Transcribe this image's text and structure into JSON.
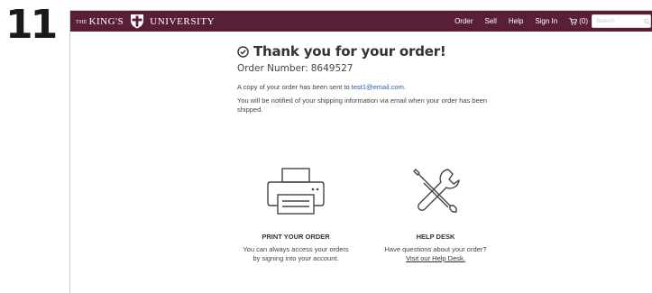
{
  "step": "11",
  "header": {
    "brand": {
      "prefix": "THE",
      "name": "KING'S",
      "suffix": "UNIVERSITY"
    },
    "nav": {
      "order": "Order",
      "sell": "Sell",
      "help": "Help",
      "sign_in": "Sign In",
      "cart": "(0)"
    },
    "search": {
      "placeholder": "Search"
    }
  },
  "confirmation": {
    "title": "Thank you for your order!",
    "order_label": "Order Number:",
    "order_number": "8649527",
    "email_prefix": "A copy of your order has been sent to",
    "email": "test1@email.com",
    "email_suffix": ".",
    "shipping_note": "You will be notified of your shipping information via email when your order has been shipped."
  },
  "cards": {
    "print": {
      "heading": "PRINT YOUR ORDER",
      "line1": "You can always access your orders",
      "line2": "by signing into your account."
    },
    "help": {
      "heading": "HELP DESK",
      "line1": "Have questions about your order?",
      "link": "Visit our Help Desk."
    }
  },
  "colors": {
    "navbar": "#5a1f38",
    "link": "#2a5db0"
  },
  "icons": [
    "shield-logo-icon",
    "cart-icon",
    "search-icon",
    "check-circle-icon",
    "printer-icon",
    "tools-icon"
  ]
}
